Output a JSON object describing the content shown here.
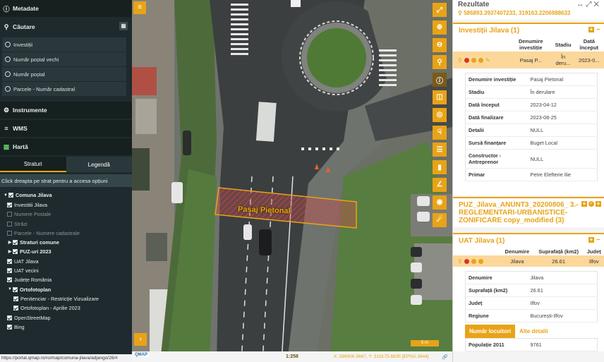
{
  "left": {
    "metadata_title": "Metadate",
    "search_title": "Căutare",
    "search_items": [
      "Investiții",
      "Număr poștal vechi",
      "Număr poștal",
      "Parcele - Număr cadastral"
    ],
    "tools_title": "Instrumente",
    "wms_title": "WMS",
    "map_title": "Hartă",
    "tabs": [
      "Straturi",
      "Legendă"
    ],
    "hint": "Click dreapta pe strat pentru a accesa opțiuni",
    "layers": [
      {
        "label": "Comuna Jilava",
        "checked": true,
        "bold": true,
        "level": 0,
        "arrow": "down"
      },
      {
        "label": "Investitii Jilava",
        "checked": true,
        "level": 1
      },
      {
        "label": "Numere Postale",
        "checked": false,
        "level": 1,
        "disabled": true
      },
      {
        "label": "Străzi",
        "checked": false,
        "level": 1,
        "disabled": true
      },
      {
        "label": "Parcele - Numere cadastrale",
        "checked": false,
        "level": 1,
        "disabled": true
      },
      {
        "label": "Straturi comune",
        "checked": true,
        "bold": true,
        "level": 1,
        "arrow": "right"
      },
      {
        "label": "PUZ-uri 2023",
        "checked": true,
        "bold": true,
        "level": 1,
        "arrow": "right"
      },
      {
        "label": "UAT Jilava",
        "checked": true,
        "level": 1
      },
      {
        "label": "UAT vecini",
        "checked": true,
        "level": 1
      },
      {
        "label": "Județe România",
        "checked": true,
        "level": 1
      },
      {
        "label": "Ortofotoplan",
        "checked": true,
        "bold": true,
        "level": 1,
        "arrow": "down"
      },
      {
        "label": "Penitenciar - Restricție Vizualizare",
        "checked": true,
        "level": 2
      },
      {
        "label": "Ortofotoplan - Aprilie 2023",
        "checked": true,
        "level": 2
      },
      {
        "label": "OpenStreetMap",
        "checked": true,
        "level": 1
      },
      {
        "label": "Bing",
        "checked": true,
        "level": 1
      }
    ],
    "status_url": "https://portal.qmap.ro/ro/map/comuna-jilava/adjango/26/#"
  },
  "map": {
    "label": "Pasaj Pietonal",
    "scale_bar": "5 m",
    "scale": "1:258",
    "coords": "X: 586906.5667, Y: 319175.6835",
    "epsg": "[EPSG:3844]",
    "logo": "QMAP",
    "tools": [
      "fullscreen-icon",
      "zoom-in-icon",
      "zoom-out-icon",
      "zoom-box-icon",
      "info-icon",
      "legend-icon",
      "locate-icon",
      "measure-icon",
      "layers-icon",
      "ruler-icon",
      "angle-icon",
      "camera-icon",
      "street-view-icon"
    ],
    "accent": "#e8a317"
  },
  "results": {
    "title": "Rezultate",
    "coords": "586893.3937407233, 319163.2206988633",
    "cards": {
      "investitii": {
        "title": "Investiții Jilava (1)",
        "headers": [
          "Denumire investiție",
          "Stadiu",
          "Dată început"
        ],
        "row": [
          "Pasaj P...",
          "În deru...",
          "2023-0..."
        ],
        "details": [
          [
            "Denumire investiție",
            "Pasaj Pietonal"
          ],
          [
            "Stadiu",
            "În derulare"
          ],
          [
            "Dată început",
            "2023-04-12"
          ],
          [
            "Dată finalizare",
            "2023-08-25"
          ],
          [
            "Detalii",
            "NULL"
          ],
          [
            "Sursă finanțare",
            "Buget Local"
          ],
          [
            "Constructor - Antreprenor",
            "NULL"
          ],
          [
            "Primar",
            "Petre Elefterie Ilie"
          ]
        ]
      },
      "puz": {
        "title": "PUZ_Jilava_ANUNT3_20200806_ 3.-REGLEMENTARI-URBANISTICE-ZONIFICARE copy_modified (3)"
      },
      "uat": {
        "title": "UAT Jilava (1)",
        "headers": [
          "Denumire",
          "Suprafață (km2)",
          "Județ"
        ],
        "row": [
          "Jilava",
          "26.61",
          "Ilfov"
        ],
        "details": [
          [
            "Denumire",
            "Jilava"
          ],
          [
            "Suprafață (km2)",
            "26.61"
          ],
          [
            "Județ",
            "Ilfov"
          ],
          [
            "Regiune",
            "București-Ilfov"
          ]
        ],
        "subtabs": [
          "Număr locuitori",
          "Alte detalii"
        ],
        "population": [
          "Populație 2011",
          "9761"
        ]
      }
    }
  }
}
